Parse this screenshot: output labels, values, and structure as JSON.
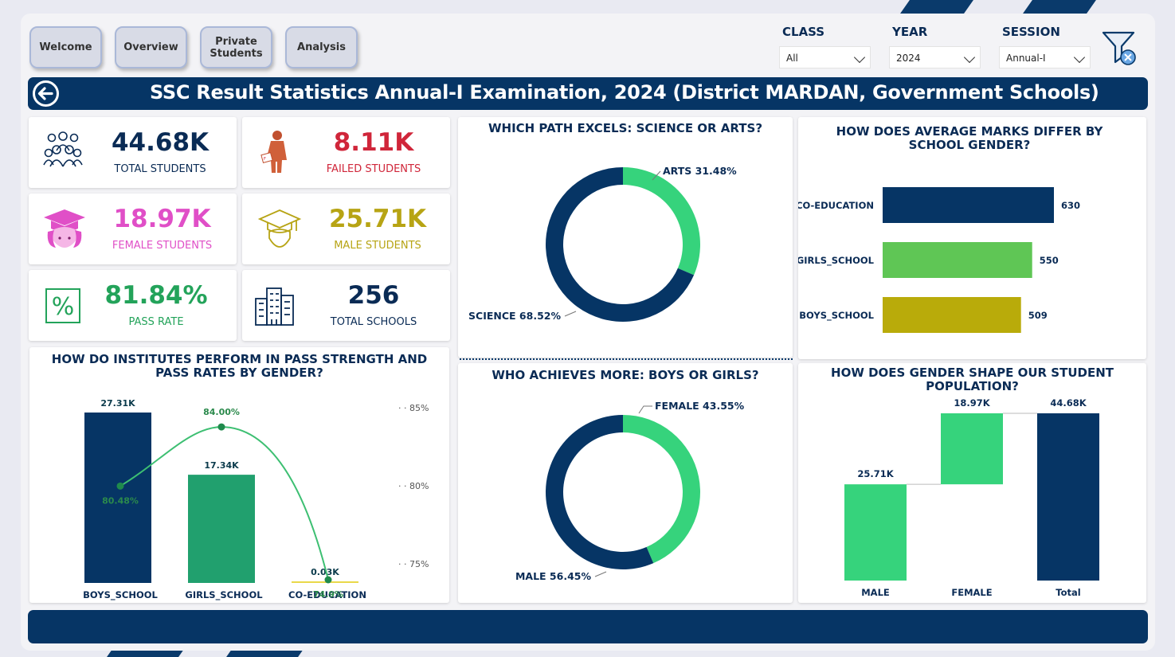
{
  "nav": {
    "welcome": "Welcome",
    "overview": "Overview",
    "private": "Private\nStudents",
    "analysis": "Analysis"
  },
  "filters": {
    "class_label": "CLASS",
    "class_value": "All",
    "year_label": "YEAR",
    "year_value": "2024",
    "session_label": "SESSION",
    "session_value": "Annual-I"
  },
  "title": "SSC Result Statistics Annual-I Examination, 2024 (District MARDAN, Government Schools)",
  "kpis": {
    "total_students": {
      "value": "44.68K",
      "label": "TOTAL STUDENTS",
      "color": "#0a2b55"
    },
    "failed_students": {
      "value": "8.11K",
      "label": "FAILED STUDENTS",
      "color": "#d0263a"
    },
    "female_students": {
      "value": "18.97K",
      "label": "FEMALE STUDENTS",
      "color": "#e04fc7"
    },
    "male_students": {
      "value": "25.71K",
      "label": "MALE STUDENTS",
      "color": "#b7a414"
    },
    "pass_rate": {
      "value": "81.84%",
      "label": "PASS RATE",
      "color": "#23a35a"
    },
    "total_schools": {
      "value": "256",
      "label": "TOTAL SCHOOLS",
      "color": "#0a2b55"
    }
  },
  "colors": {
    "navy": "#063565",
    "green": "#36d37c",
    "teal": "#21a06e",
    "lime": "#5fc655",
    "olive": "#b9ab0a"
  },
  "chart_data": [
    {
      "id": "institutes",
      "type": "bar",
      "title": "HOW DO INSTITUTES PERFORM IN PASS STRENGTH AND PASS RATES BY GENDER?",
      "categories": [
        "BOYS_SCHOOL",
        "GIRLS_SCHOOL",
        "CO-EDUCATION"
      ],
      "series": [
        {
          "values": [
            27.31,
            17.34,
            0.03
          ],
          "labels": [
            "27.31K",
            "17.34K",
            "0.03K"
          ]
        },
        {
          "type": "line",
          "values": [
            80.48,
            84.0,
            74.9
          ],
          "labels": [
            "80.48%",
            "84.00%",
            "74.9%"
          ]
        }
      ],
      "y2_ticks": [
        "85%",
        "80%",
        "75%"
      ],
      "y2lim": [
        74.9,
        85
      ]
    },
    {
      "id": "science_arts",
      "type": "pie",
      "title": "WHICH PATH EXCELS: SCIENCE OR ARTS?",
      "labels": [
        "ARTS",
        "SCIENCE"
      ],
      "values": [
        31.48,
        68.52
      ],
      "display": [
        "ARTS 31.48%",
        "SCIENCE 68.52%"
      ]
    },
    {
      "id": "boys_girls",
      "type": "pie",
      "title": "WHO ACHIEVES MORE: BOYS OR GIRLS?",
      "labels": [
        "FEMALE",
        "MALE"
      ],
      "values": [
        43.55,
        56.45
      ],
      "display": [
        "FEMALE 43.55%",
        "MALE 56.45%"
      ]
    },
    {
      "id": "avg_marks",
      "type": "bar",
      "orientation": "horizontal",
      "title": "HOW DOES AVERAGE MARKS DIFFER BY SCHOOL GENDER?",
      "categories": [
        "CO-EDUCATION",
        "GIRLS_SCHOOL",
        "BOYS_SCHOOL"
      ],
      "values": [
        630,
        550,
        509
      ]
    },
    {
      "id": "population",
      "type": "bar",
      "subtype": "waterfall",
      "title": "HOW DOES GENDER SHAPE OUR STUDENT POPULATION?",
      "categories": [
        "MALE",
        "FEMALE",
        "Total"
      ],
      "values": [
        25.71,
        18.97,
        44.68
      ],
      "labels": [
        "25.71K",
        "18.97K",
        "44.68K"
      ]
    }
  ]
}
